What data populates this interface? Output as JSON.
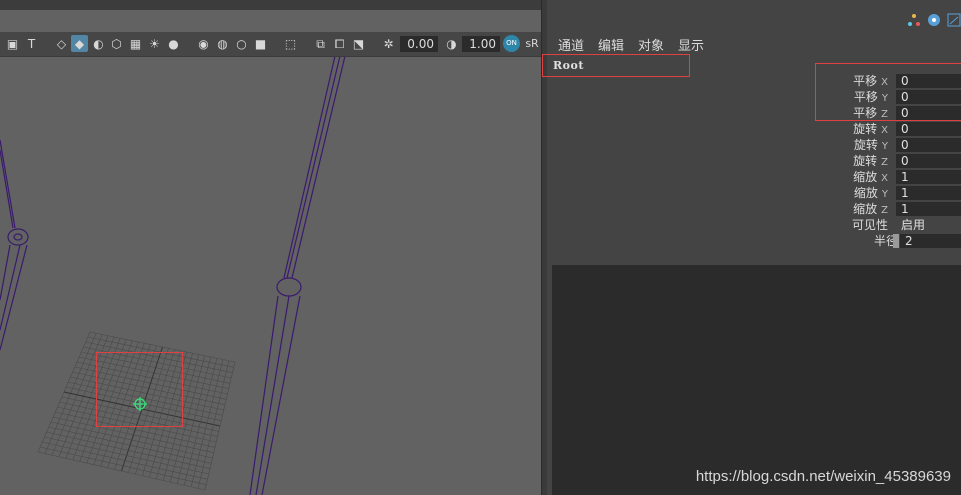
{
  "viewport": {
    "toolbar": {
      "exposure_value": "0.00",
      "gamma_value": "1.00",
      "on_badge": "ON",
      "colorspace_label": "sR"
    }
  },
  "channel_box": {
    "menu": [
      "通道",
      "编辑",
      "对象",
      "显示"
    ],
    "object_name": "Root",
    "attributes": [
      {
        "label": "平移",
        "axis": "X",
        "value": "0"
      },
      {
        "label": "平移",
        "axis": "Y",
        "value": "0"
      },
      {
        "label": "平移",
        "axis": "Z",
        "value": "0"
      },
      {
        "label": "旋转",
        "axis": "X",
        "value": "0"
      },
      {
        "label": "旋转",
        "axis": "Y",
        "value": "0"
      },
      {
        "label": "旋转",
        "axis": "Z",
        "value": "0"
      },
      {
        "label": "缩放",
        "axis": "X",
        "value": "1"
      },
      {
        "label": "缩放",
        "axis": "Y",
        "value": "1"
      },
      {
        "label": "缩放",
        "axis": "Z",
        "value": "1"
      },
      {
        "label": "可见性",
        "axis": "",
        "value": "启用"
      },
      {
        "label": "半径",
        "axis": "",
        "value": "2"
      }
    ]
  },
  "watermark": "https://blog.csdn.net/weixin_45389639",
  "colors": {
    "viewport_bg": "#626262",
    "panel_bg": "#444444",
    "highlight": "#e0403f",
    "joint_purple": "#3a1a6e",
    "locator_green": "#39e07a",
    "active_tool": "#5285a6"
  }
}
